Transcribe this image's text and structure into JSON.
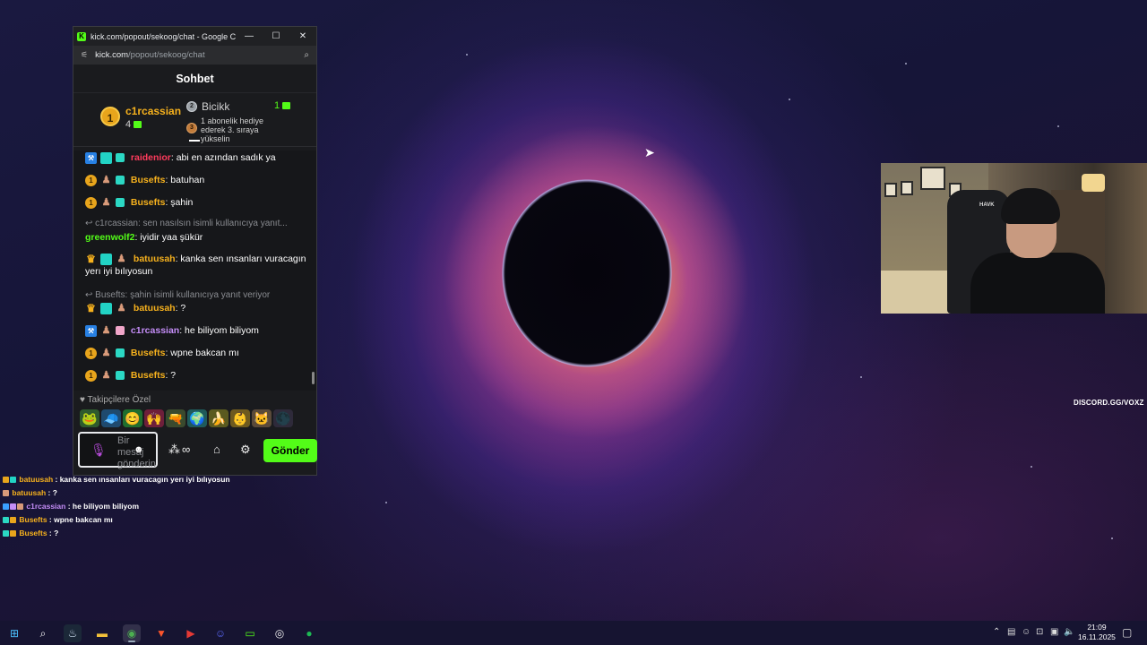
{
  "browser": {
    "window_title": "kick.com/popout/sekoog/chat - Google Chr...",
    "url_host": "kick.com",
    "url_path": "/popout/sekoog/chat"
  },
  "chat": {
    "header": "Sohbet",
    "leaderboard": {
      "first": {
        "rank": "1",
        "name": "c1rcassian",
        "count": "4"
      },
      "second": {
        "rank": "2",
        "name": "Bicikk",
        "count": "1"
      },
      "third_rank": "3",
      "note": "1 abonelik hediye ederek 3. sıraya yükselin"
    },
    "messages": [
      {
        "user": "raidenior",
        "text": ": abi en azından sadık ya"
      },
      {
        "user": "Busefts",
        "text": ": batuhan"
      },
      {
        "user": "Busefts",
        "text": ": şahin"
      },
      {
        "reply": "c1rcassian: sen nasılsın isimli kullanıcıya yanıt..."
      },
      {
        "user": "greenwolf2",
        "text": ": iyidir yaa şükür"
      },
      {
        "user": "batuusah",
        "text": ": kanka sen ınsanları vuracagın yerı iyi bılıyosun"
      },
      {
        "reply": "Busefts: şahin isimli kullanıcıya yanıt veriyor"
      },
      {
        "user": "batuusah",
        "text": ": ?"
      },
      {
        "user": "c1rcassian",
        "text": ": he biliyom biliyom"
      },
      {
        "user": "Busefts",
        "text": ": wpne bakcan mı"
      },
      {
        "user": "Busefts",
        "text": ": ?"
      }
    ],
    "followers_only": "Takipçilere Özel",
    "input_placeholder": "Bir mesaj gönderin",
    "infinity": "∞",
    "send_label": "Gönder"
  },
  "overlay_chat": [
    {
      "user": "batuusah",
      "text": " : kanka sen ınsanları vuracagın yerı iyi bılıyosun"
    },
    {
      "user": "batuusah",
      "text": " : ?"
    },
    {
      "user": "c1rcassian",
      "text": " : he biliyom biliyom"
    },
    {
      "user": "Busefts",
      "text": " : wpne bakcan mı"
    },
    {
      "user": "Busefts",
      "text": " : ?"
    }
  ],
  "webcam": {
    "chair_brand": "HAVK"
  },
  "stream_tag": "DISCORD.GG/VOXZ",
  "taskbar": {
    "time": "21:09",
    "date": "16.11.2025"
  },
  "colors": {
    "kick_green": "#53fc18",
    "user_orange": "#f6b11d",
    "user_green": "#53fc18",
    "user_red": "#ff3b5c",
    "user_purple": "#c48df7"
  }
}
